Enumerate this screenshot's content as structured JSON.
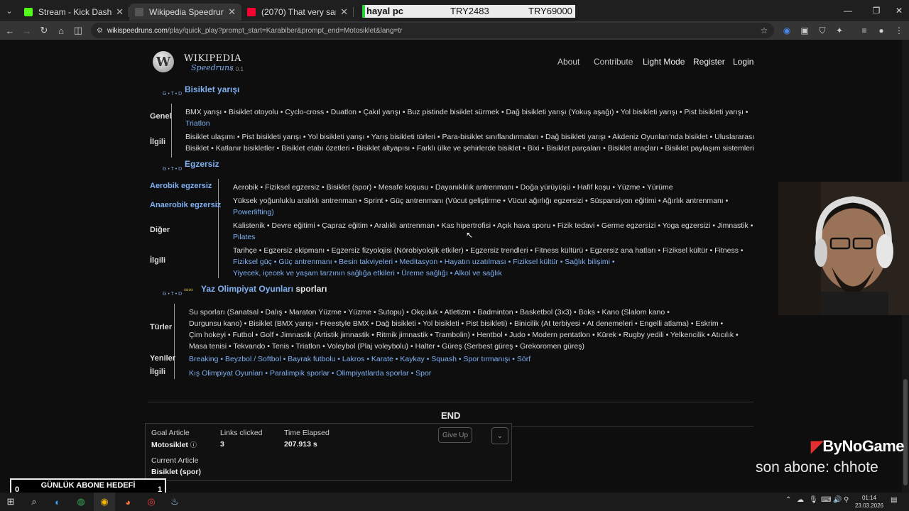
{
  "browser": {
    "tabs": [
      {
        "title": "Stream - Kick Dashboard",
        "color": "#53fc18",
        "active": false
      },
      {
        "title": "Wikipedia Speedrunsl",
        "color": "#444444",
        "active": true
      },
      {
        "title": "(2070) That very same berry sin",
        "color": "#ff0033",
        "active": false
      }
    ],
    "overlay": {
      "label": "hayal pc",
      "value1": "TRY2483",
      "value2": "TRY69000"
    },
    "url_host": "wikispeedruns.com",
    "url_path": "/play/quick_play?prompt_start=Karabiber&prompt_end=Motosiklet&lang=tr"
  },
  "site": {
    "logo": {
      "word": "Wikipedia",
      "sub": "Speedruns",
      "version": "v. 0.1"
    },
    "nav": [
      "About",
      "Contribute",
      "Light Mode",
      "Register",
      "Login"
    ]
  },
  "vte": "G • T • D",
  "boxes": {
    "bisiklet": {
      "title": "Bisiklet yarışı",
      "groups": [
        {
          "label": "Genel",
          "lines": [
            "BMX yarışı • Bisiklet otoyolu • Cyclo-cross • Duatlon • Çakıl yarışı • Buz pistinde bisiklet sürmek • Dağ bisikleti yarışı      (Yokuş aşağı) • Yol bisikleti yarışı • Pist bisikleti yarışı •",
            "Triatlon"
          ]
        },
        {
          "label": "İlgili",
          "lines": [
            "Bisiklet ulaşımı • Pist bisikleti yarışı • Yol bisikleti yarışı • Yarış bisikleti türleri • Para-bisiklet sınıflandırmaları • Dağ bisikleti yarışı • Akdeniz Oyunları'nda bisiklet • Uluslararası",
            "Bisiklet • Katlanır bisikletler • Bisiklet etabı özetleri • Bisiklet altyapısı • Farklı ülke ve şehirlerde bisiklet • Bixi • Bisiklet parçaları • Bisiklet araçları • Bisiklet paylaşım sistemleri"
          ]
        }
      ]
    },
    "egzersiz": {
      "title": "Egzersiz",
      "groups": [
        {
          "label": "Aerobik egzersiz",
          "lines": [
            "Aerobik • Fiziksel egzersiz • Bisiklet (spor) • Mesafe koşusu • Dayanıklılık antrenmanı • Doğa yürüyüşü • Hafif koşu • Yüzme • Yürüme"
          ]
        },
        {
          "label": "Anaerobik egzersiz",
          "lines": [
            "Yüksek yoğunluklu aralıklı antrenman • Sprint • Güç antrenmanı      (Vücut geliştirme • Vücut ağırlığı egzersizi • Süspansiyon eğitimi • Ağırlık antrenmanı •",
            "Powerlifting)"
          ]
        },
        {
          "label": "Diğer",
          "lines": [
            "Kalistenik • Devre eğitimi • Çapraz eğitim • Aralıklı antrenman • Kas hipertrofisi • Açık hava sporu • Fizik tedavi • Germe egzersizi • Yoga egzersizi • Jimnastik •",
            "Pilates"
          ]
        },
        {
          "label": "İlgili",
          "lines": [
            "Tarihçe • Egzersiz ekipmanı • Egzersiz fizyolojisi      (Nörobiyolojik etkiler) • Egzersiz trendleri • Fitness kültürü • Egzersiz ana hatları • Fiziksel kültür • Fitness •",
            "Fiziksel güç • Güç antrenmanı • Besin takviyeleri • Meditasyon • Hayatın uzatılması • Fiziksel kültür • Sağlık bilişimi •",
            "Yiyecek, içecek ve yaşam tarzının sağlığa etkileri • Üreme sağlığı • Alkol ve sağlık"
          ]
        }
      ]
    },
    "olimpiyat": {
      "title_link": "Yaz Olimpiyat Oyunları",
      "title_rest": " sporları",
      "groups": [
        {
          "label": "Türler",
          "lines": [
            "Su sporları      (Sanatsal • Dalış • Maraton Yüzme • Yüzme • Sutopu) • Okçuluk • Atletizm • Badminton • Basketbol      (3x3) • Boks • Kano      (Slalom kano •",
            "Durgunsu kano) • Bisiklet      (BMX yarışı • Freestyle BMX • Dağ bisikleti • Yol bisikleti • Pist bisikleti) • Binicilik      (At terbiyesi • At denemeleri • Engelli atlama) • Eskrim •",
            "Çim hokeyi • Futbol • Golf • Jimnastik      (Artistik jimnastik • Ritmik jimnastik • Trambolin) • Hentbol • Judo • Modern pentatlon • Kürek • Rugby yedili • Yelkencilik • Atıcılık •",
            "Masa tenisi • Tekvando • Tenis • Triatlon • Voleybol      (Plaj voleybolu) • Halter • Güreş      (Serbest güreş • Grekoromen güreş)"
          ]
        },
        {
          "label": "Yeniler",
          "lines": [
            "Breaking • Beyzbol / Softbol • Bayrak futbolu • Lakros • Karate • Kaykay • Squash • Spor tırmanışı • Sörf"
          ]
        },
        {
          "label": "İlgili",
          "lines": [
            "Kış Olimpiyat Oyunları • Paralimpik sporlar • Olimpiyatlarda sporlar • Spor"
          ]
        }
      ]
    }
  },
  "game": {
    "end": "END",
    "goal_label": "Goal Article",
    "goal": "Motosiklet",
    "goal_icon": "ⓘ",
    "links_label": "Links clicked",
    "links": "3",
    "time_label": "Time Elapsed",
    "time": "207.913 s",
    "current_label": "Current Article",
    "current": "Bisiklet (spor)",
    "giveup": "Give Up"
  },
  "overlay": {
    "sub_title": "GÜNLÜK ABONE HEDEFİ",
    "sub_current": "0",
    "sub_goal": "1",
    "brand": "ByNoGame",
    "last_sub": "son abone: chhote"
  },
  "taskbar": {
    "time": "01:14",
    "date": "23.03.2026"
  }
}
